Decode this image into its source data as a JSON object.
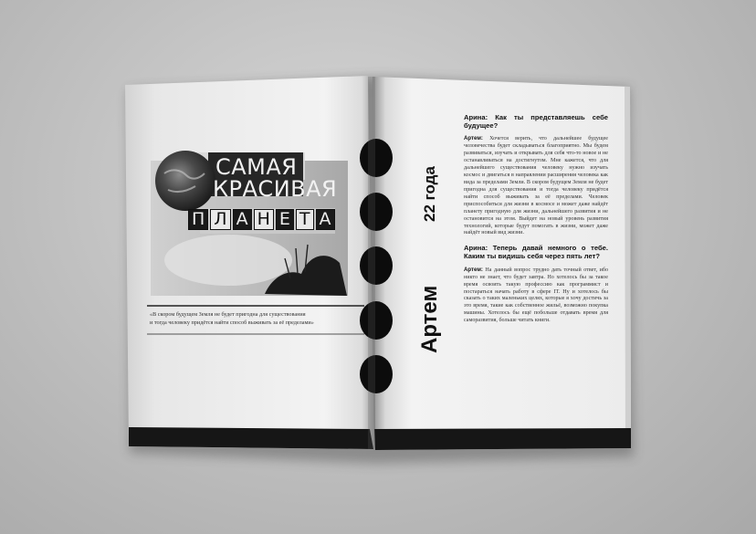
{
  "collage": {
    "line1": "САМАЯ",
    "line2": "КРАСИВАЯ",
    "line3_letters": [
      "П",
      "Л",
      "А",
      "Н",
      "Е",
      "Т",
      "А"
    ]
  },
  "quote": {
    "text": "«В скором будущем Земля не будет пригодна для существования\nи тогда человеку придётся найти способ выживать за её пределами»"
  },
  "side": {
    "age": "22 года",
    "name": "Артем"
  },
  "interview": [
    {
      "question": "Арина: Как ты представляешь себе будущее?",
      "speaker": "Артем:",
      "answer": "Хочется верить, что дальнейшее будущее человечества будет складываться благоприятно. Мы будем развиваться, изучать и открывать для себя что-то новое и не останавливаться на достигнутом. Мне кажется, что для дальнейшего существования человеку нужно изучать космос и двигаться в направлении расширения человека как вида за пределами Земли. В скором будущем Земля не будет пригодна для существования и тогда человеку придётся найти способ выживать за её пределами. Человек приспособиться для жизни в космосе и может даже найдёт планету пригодную для жизни, дальнейшего развития и не остановится на этом. Выйдет на новый уровень развития технологий, которые будут помогать в жизни, может даже найдёт новый вид жизни."
    },
    {
      "question": "Арина: Теперь давай немного о тебе. Каким ты видишь себя через пять лет?",
      "speaker": "Артем:",
      "answer": "На данный вопрос трудно дать точный ответ, ибо никто не знает, что будет завтра. Но хотелось бы за такое время освоить такую профессию как программист и постараться начать работу в сфере IT. Ну и хотелось бы сказать о таких маленьких целях, которые я хочу достичь за это время, такие как собственное жильё, возможно покупка машины. Хотелось бы ещё побольше отдавать время для саморазвития, больше читать книги."
    }
  ],
  "colors": {
    "page": "#f1f1f1",
    "ink": "#111111",
    "background": "#bdbdbd"
  }
}
